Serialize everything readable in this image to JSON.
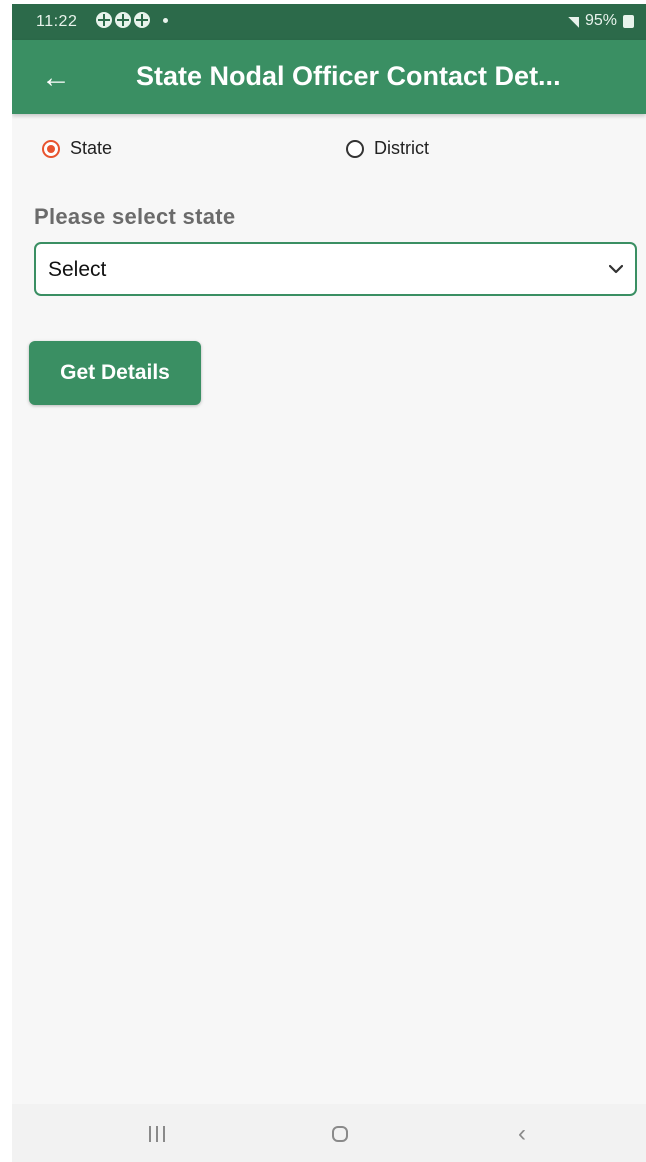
{
  "status_bar": {
    "time": "11:22",
    "battery": "95%",
    "notification_icons": [
      "notification-icon",
      "notification-icon",
      "notification-icon"
    ]
  },
  "app_bar": {
    "title": "State Nodal Officer Contact Det...",
    "back_icon": "arrow-left-icon"
  },
  "radio_group": {
    "options": [
      {
        "label": "State",
        "checked": true
      },
      {
        "label": "District",
        "checked": false
      }
    ]
  },
  "form": {
    "state_label": "Please select state",
    "state_select": {
      "value": "Select"
    },
    "submit_label": "Get Details"
  },
  "colors": {
    "status_bar": "#2c6a4a",
    "app_bar": "#3a8f63",
    "accent_radio": "#e8542f",
    "background": "#f7f7f7"
  }
}
